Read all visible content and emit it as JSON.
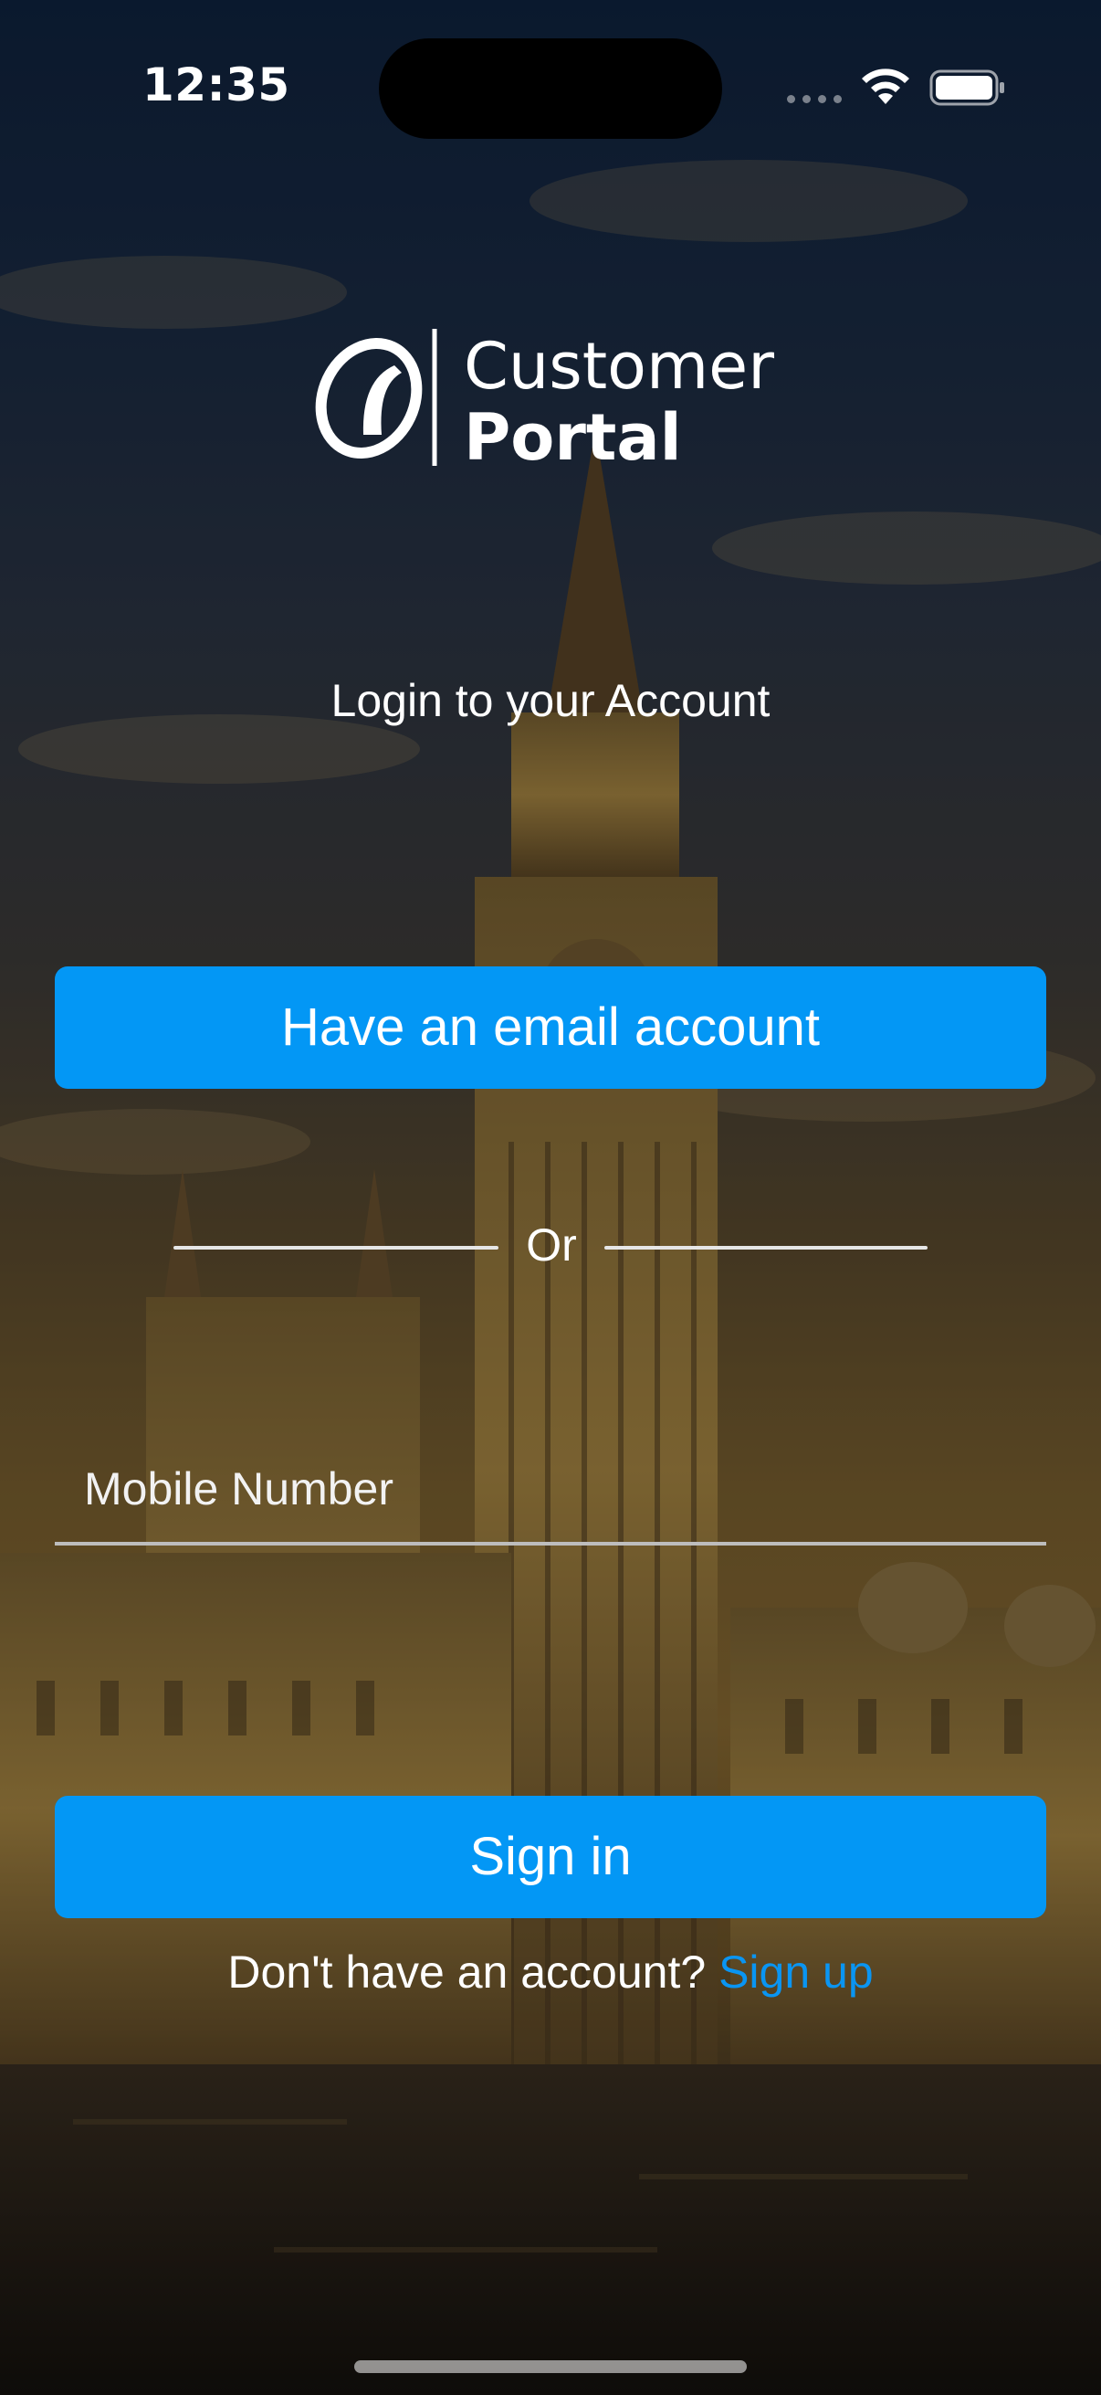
{
  "status_bar": {
    "time": "12:35"
  },
  "logo": {
    "line1": "Customer",
    "line2": "Portal"
  },
  "login": {
    "title": "Login to your Account",
    "email_button_label": "Have an email account",
    "divider_text": "Or",
    "mobile_placeholder": "Mobile Number",
    "mobile_value": "",
    "signin_button_label": "Sign in",
    "no_account_text": "Don't have an account?",
    "signup_link_label": "Sign up"
  },
  "colors": {
    "primary": "#0397f5",
    "link": "#0a95f2",
    "text": "#ffffff"
  },
  "icons": [
    "wifi-icon",
    "battery-icon",
    "logo-mark-icon"
  ]
}
